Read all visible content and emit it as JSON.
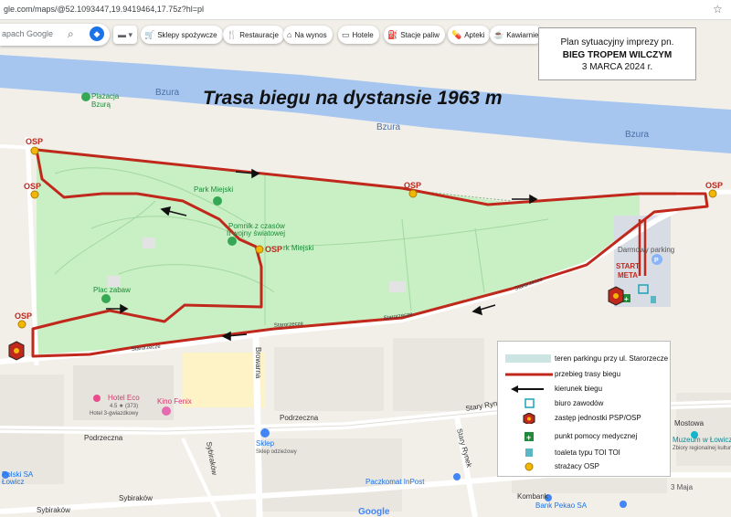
{
  "browser": {
    "url": "gle.com/maps/@52.1093447,19.9419464,17.75z?hl=pl"
  },
  "toolbar": {
    "search_placeholder": "apach Google",
    "chips": [
      {
        "icon": "🛒",
        "label": "Sklepy spożywcze"
      },
      {
        "icon": "🍴",
        "label": "Restauracje"
      },
      {
        "icon": "⌂",
        "label": "Na wynos"
      },
      {
        "icon": "▭",
        "label": "Hotele"
      },
      {
        "icon": "⛽",
        "label": "Stacje paliw"
      },
      {
        "icon": "💊",
        "label": "Apteki"
      },
      {
        "icon": "☕",
        "label": "Kawiarnie"
      }
    ]
  },
  "plan_box": {
    "line1": "Plan sytuacyjny imprezy pn.",
    "line2": "BIEG TROPEM WILCZYM",
    "line3": "3 MARCA 2024 r."
  },
  "map": {
    "title": "Trasa biegu na dystansie 1963 m",
    "river_name": "Bzura",
    "labels": {
      "plazacja": "Plażacja",
      "plazacja2": "Bzurą",
      "park": "Park Miejski",
      "pomnik1": "Pomnik z czasów",
      "pomnik2": "II wojny światowej",
      "park2": "rk Miejski",
      "plac": "Plac zabaw",
      "darmowy": "Darmowy parking",
      "start": "START",
      "meta": "META",
      "hotel": "Hotel Eco",
      "hotel_rating": "4.5 ★ (373)",
      "hotel_type": "Hotel 3-gwiazdkowy",
      "kino": "Kino Fenix",
      "sklep": "Sklep",
      "sklep_type": "Sklep odzieżowy",
      "paczkomat": "Paczkomat InPost",
      "bank1": "Bank Pekao SA",
      "bank0": "Kombank",
      "muzeum": "Muzeum w Łowiczu",
      "muzeum_type": "Zbiory regionalnej kultury",
      "polski1": "Polski SA",
      "polski2": "Łowicz",
      "maja": "3 Maja",
      "google": "Google",
      "osp": "OSP"
    },
    "streets": {
      "podrzeczna": "Podrzeczna",
      "sybirakow": "Sybiraków",
      "browarna": "Browarna",
      "stary_rynek": "Stary Rynek",
      "mostowa": "Mostowa",
      "starorzecze": "Starorzecze"
    }
  },
  "legend": {
    "items": [
      {
        "label": "teren parkingu przy ul. Starorzecze"
      },
      {
        "label": "przebieg trasy biegu"
      },
      {
        "label": "kierunek biegu"
      },
      {
        "label": "biuro zawodów"
      },
      {
        "label": "zastęp jednostki PSP/OSP"
      },
      {
        "label": "punkt pomocy medycznej"
      },
      {
        "label": "toaleta typu TOI TOI"
      },
      {
        "label": "strażacy OSP"
      }
    ]
  },
  "colors": {
    "route": "#c0281c",
    "river": "#a6c6f0",
    "park": "#c8f0c4",
    "osp_dot": "#f2b705",
    "legend_parking": "#cce4e2"
  }
}
